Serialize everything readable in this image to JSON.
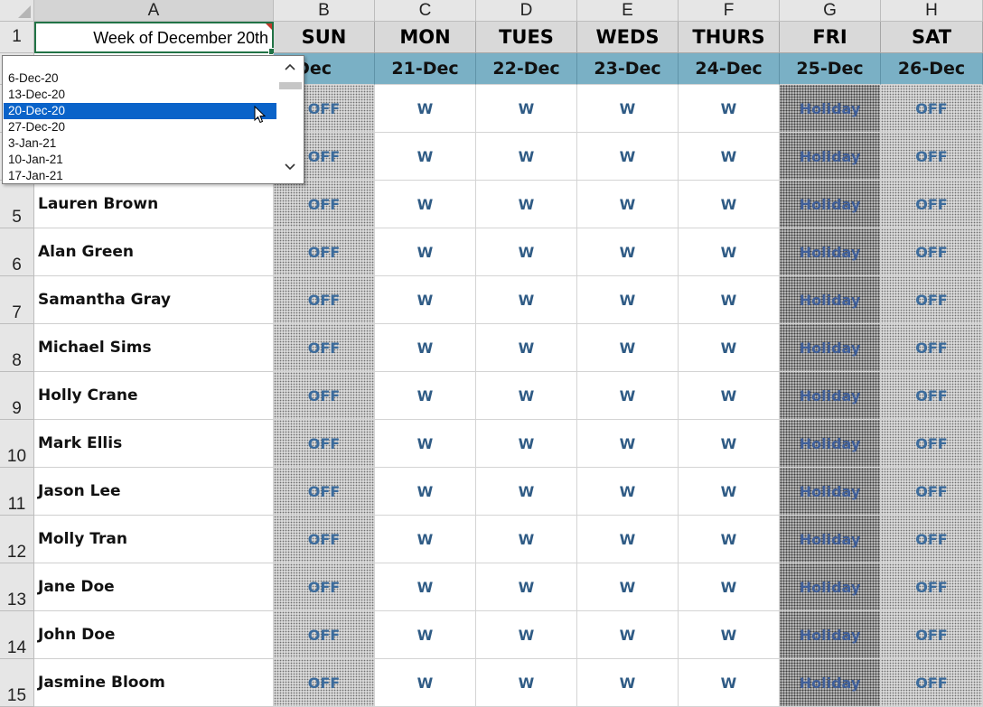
{
  "spreadsheet": {
    "columns": [
      "A",
      "B",
      "C",
      "D",
      "E",
      "F",
      "G",
      "H"
    ],
    "active_column": "A",
    "row_numbers": [
      "1",
      "5",
      "6",
      "7",
      "8",
      "9",
      "10",
      "11",
      "12",
      "13",
      "14",
      "15"
    ],
    "a1_value": "Week of December 20th",
    "days": [
      "SUN",
      "MON",
      "TUES",
      "WEDS",
      "THURS",
      "FRI",
      "SAT"
    ],
    "dates": [
      "0-Dec",
      "21-Dec",
      "22-Dec",
      "23-Dec",
      "24-Dec",
      "25-Dec",
      "26-Dec"
    ],
    "hidden_rows_cells": [
      [
        "OFF",
        "W",
        "W",
        "W",
        "W",
        "Holiday",
        "OFF"
      ],
      [
        "OFF",
        "W",
        "W",
        "W",
        "W",
        "Holiday",
        "OFF"
      ]
    ],
    "employees": [
      {
        "name": "Lauren Brown",
        "shifts": [
          "OFF",
          "W",
          "W",
          "W",
          "W",
          "Holiday",
          "OFF"
        ]
      },
      {
        "name": "Alan Green",
        "shifts": [
          "OFF",
          "W",
          "W",
          "W",
          "W",
          "Holiday",
          "OFF"
        ]
      },
      {
        "name": "Samantha Gray",
        "shifts": [
          "OFF",
          "W",
          "W",
          "W",
          "W",
          "Holiday",
          "OFF"
        ]
      },
      {
        "name": "Michael Sims",
        "shifts": [
          "OFF",
          "W",
          "W",
          "W",
          "W",
          "Holiday",
          "OFF"
        ]
      },
      {
        "name": "Holly Crane",
        "shifts": [
          "OFF",
          "W",
          "W",
          "W",
          "W",
          "Holiday",
          "OFF"
        ]
      },
      {
        "name": "Mark Ellis",
        "shifts": [
          "OFF",
          "W",
          "W",
          "W",
          "W",
          "Holiday",
          "OFF"
        ]
      },
      {
        "name": "Jason Lee",
        "shifts": [
          "OFF",
          "W",
          "W",
          "W",
          "W",
          "Holiday",
          "OFF"
        ]
      },
      {
        "name": "Molly Tran",
        "shifts": [
          "OFF",
          "W",
          "W",
          "W",
          "W",
          "Holiday",
          "OFF"
        ]
      },
      {
        "name": "Jane Doe",
        "shifts": [
          "OFF",
          "W",
          "W",
          "W",
          "W",
          "Holiday",
          "OFF"
        ]
      },
      {
        "name": "John Doe",
        "shifts": [
          "OFF",
          "W",
          "W",
          "W",
          "W",
          "Holiday",
          "OFF"
        ]
      },
      {
        "name": "Jasmine Bloom",
        "shifts": [
          "OFF",
          "W",
          "W",
          "W",
          "W",
          "Holiday",
          "OFF"
        ]
      }
    ]
  },
  "dropdown": {
    "options": [
      "6-Dec-20",
      "13-Dec-20",
      "20-Dec-20",
      "27-Dec-20",
      "3-Jan-21",
      "10-Jan-21",
      "17-Jan-21"
    ],
    "selected": "20-Dec-20",
    "scroll_up_icon": "chevron-up-icon",
    "scroll_down_icon": "chevron-down-icon"
  },
  "colors": {
    "date_band": "#7ab0c5",
    "selection": "#0a63c9",
    "workday_text": "#2f5b85",
    "active_border": "#217346"
  }
}
